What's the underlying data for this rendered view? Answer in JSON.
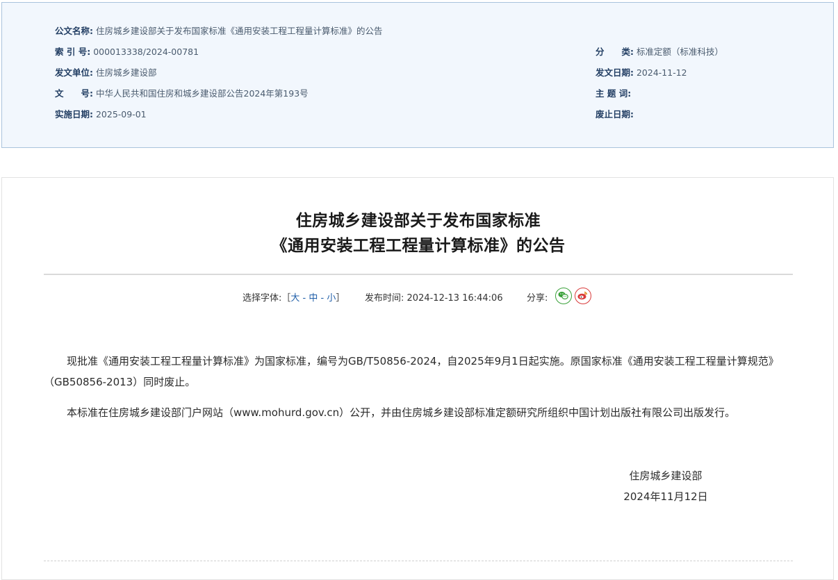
{
  "meta": {
    "name_label": "公文名称:",
    "name_value": "住房城乡建设部关于发布国家标准《通用安装工程工程量计算标准》的公告",
    "index_label": "索 引 号:",
    "index_value": "000013338/2024-00781",
    "category_label": "分　　类:",
    "category_value": "标准定额（标准科技）",
    "issuer_label": "发文单位:",
    "issuer_value": "住房城乡建设部",
    "issue_date_label": "发文日期:",
    "issue_date_value": "2024-11-12",
    "doc_no_label": "文　　号:",
    "doc_no_value": "中华人民共和国住房和城乡建设部公告2024年第193号",
    "subject_label": "主 题 词:",
    "subject_value": "",
    "effective_label": "实施日期:",
    "effective_value": "2025-09-01",
    "abolish_label": "废止日期:",
    "abolish_value": ""
  },
  "article": {
    "title_line1": "住房城乡建设部关于发布国家标准",
    "title_line2": "《通用安装工程工程量计算标准》的公告",
    "font_select_label": "选择字体:［",
    "font_large": "大",
    "font_sep1": " - ",
    "font_medium": "中",
    "font_sep2": " - ",
    "font_small": "小",
    "font_close": "］",
    "publish_time_label": "发布时间:",
    "publish_time_value": "2024-12-13 16:44:06",
    "share_label": "分享:",
    "paragraph1": "现批准《通用安装工程工程量计算标准》为国家标准，编号为GB/T50856-2024，自2025年9月1日起实施。原国家标准《通用安装工程工程量计算规范》（GB50856-2013）同时废止。",
    "paragraph2": "本标准在住房城乡建设部门户网站（www.mohurd.gov.cn）公开，并由住房城乡建设部标准定额研究所组织中国计划出版社有限公司出版发行。",
    "signature_org": "住房城乡建设部",
    "signature_date": "2024年11月12日"
  },
  "colors": {
    "meta_bg": "#f2f7fd",
    "meta_border": "#a9c3dc",
    "link": "#1f5ea8",
    "wechat": "#3aa13a",
    "weibo": "#d93a3a"
  },
  "icons": {
    "wechat": "wechat-icon",
    "weibo": "weibo-icon"
  }
}
